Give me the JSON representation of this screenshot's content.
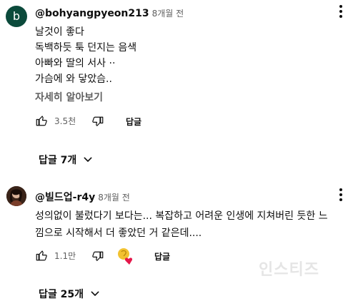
{
  "comments": [
    {
      "avatar_letter": "b",
      "handle": "@bohyangpyeon213",
      "time": "8개월 전",
      "lines": [
        "날것이 좋다",
        "독백하듯  툭 던지는 음색",
        "아빠와 딸의 서사 ··",
        "가슴에 와 닿았슴.."
      ],
      "read_more": "자세히 알아보기",
      "likes": "3.5천",
      "reply_label": "답글",
      "replies_toggle": "답글 7개"
    },
    {
      "handle": "@빌드업-r4y",
      "time": "8개월 전",
      "lines": [
        "성의없이 불렀다기 보다는... 복잡하고 어려운 인생에 지쳐버린 듯한 느",
        "낌으로 시작해서 더 좋았던 거 같은데...."
      ],
      "likes": "1.1만",
      "reply_label": "답글",
      "replies_toggle": "답글 25개"
    }
  ],
  "watermark": "인스티즈"
}
